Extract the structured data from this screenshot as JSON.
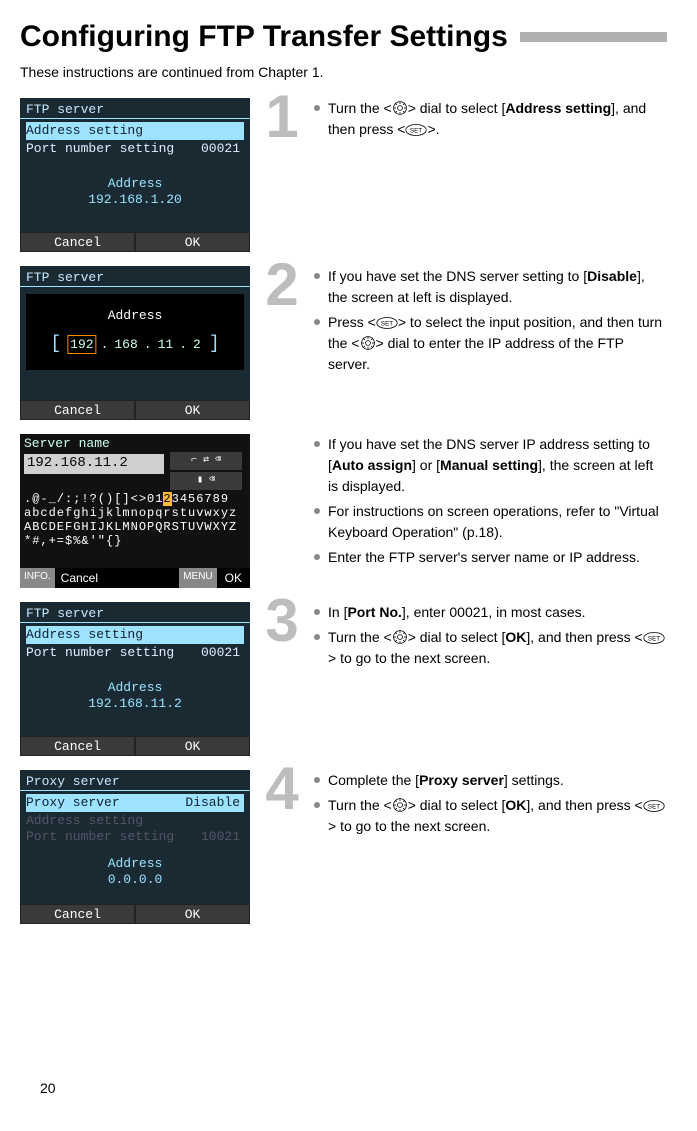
{
  "title": "Configuring FTP Transfer Settings",
  "intro": "These instructions are continued from Chapter 1.",
  "page_number": "20",
  "icons": {
    "dial": "dial-icon",
    "set": "set-icon"
  },
  "screens": {
    "s1": {
      "title": "FTP server",
      "row1": "Address setting",
      "row2_label": "Port number setting",
      "row2_value": "00021",
      "addr_label": "Address",
      "addr_value": "192.168.1.20",
      "cancel": "Cancel",
      "ok": "OK"
    },
    "s2a": {
      "title": "FTP server",
      "addr_label": "Address",
      "ip": [
        "192",
        "168",
        "11",
        "2"
      ],
      "cancel": "Cancel",
      "ok": "OK"
    },
    "s2b": {
      "title": "Server name",
      "field": "192.168.11.2",
      "kb_line1_a": ".@-_/:;!?()[]<>01",
      "kb_line1_sel": "2",
      "kb_line1_b": "3456789",
      "kb_line2": "abcdefghijklmnopqrstuvwxyz",
      "kb_line3": "ABCDEFGHIJKLMNOPQRSTUVWXYZ",
      "kb_line4": "*#,+=$%&'\"{}",
      "info": "INFO.",
      "cancel": "Cancel",
      "menu": "MENU",
      "ok": "OK"
    },
    "s3": {
      "title": "FTP server",
      "row1": "Address setting",
      "row2_label": "Port number setting",
      "row2_value": "00021",
      "addr_label": "Address",
      "addr_value": "192.168.11.2",
      "cancel": "Cancel",
      "ok": "OK"
    },
    "s4": {
      "title": "Proxy server",
      "row1_label": "Proxy server",
      "row1_value": "Disable",
      "row2": "Address setting",
      "row3_label": "Port number setting",
      "row3_value": "10021",
      "addr_label": "Address",
      "addr_value": "0.0.0.0",
      "cancel": "Cancel",
      "ok": "OK"
    }
  },
  "steps": {
    "n1": "1",
    "n2": "2",
    "n3": "3",
    "n4": "4",
    "b1_a": "Turn the <",
    "b1_b": "> dial to select [",
    "b1_bold": "Address setting",
    "b1_c": "], and then press <",
    "b1_d": ">.",
    "b2a_a": "If you have set the DNS server setting to [",
    "b2a_bold": "Disable",
    "b2a_b": "], the screen at left is displayed.",
    "b2b_a": "Press <",
    "b2b_b": "> to select the input position, and then turn the <",
    "b2b_c": "> dial to enter the IP address of the FTP server.",
    "b2c_a": "If you have set the DNS server IP address setting to [",
    "b2c_bold1": "Auto assign",
    "b2c_b": "] or [",
    "b2c_bold2": "Manual setting",
    "b2c_c": "], the screen at left is displayed.",
    "b2d": "For instructions on screen operations, refer to \"Virtual Keyboard Operation\" (p.18).",
    "b2e": "Enter the FTP server's server name or IP address.",
    "b3a_a": "In [",
    "b3a_bold": "Port No.",
    "b3a_b": "], enter 00021, in most cases.",
    "b3b_a": "Turn the <",
    "b3b_b": "> dial to select [",
    "b3b_bold": "OK",
    "b3b_c": "], and then press <",
    "b3b_d": "> to go to the next screen.",
    "b4a_a": "Complete the [",
    "b4a_bold": "Proxy server",
    "b4a_b": "] settings.",
    "b4b_a": "Turn the <",
    "b4b_b": "> dial to select [",
    "b4b_bold": "OK",
    "b4b_c": "], and then press <",
    "b4b_d": "> to go to the next screen."
  }
}
